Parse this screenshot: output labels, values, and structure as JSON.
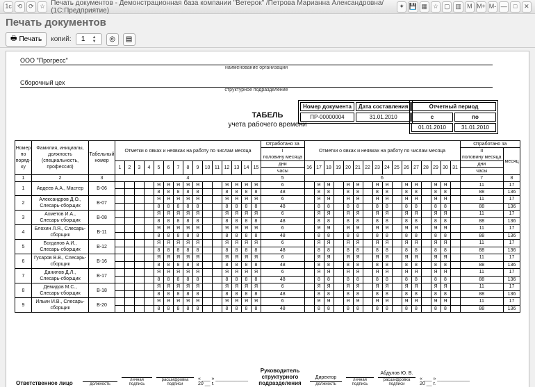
{
  "window": {
    "title": "Печать документов - Демонстрационная база компании \"Ветерок\" /Петрова Марианна Александровна/  (1С:Предприятие)"
  },
  "header": {
    "title": "Печать документов"
  },
  "toolbar": {
    "print": "Печать",
    "copies_label": "копий:",
    "copies": "1"
  },
  "org": {
    "name": "ООО \"Прогресс\"",
    "caption": "наименование организации"
  },
  "unit": {
    "name": "Сборочный цех",
    "caption": "структурное подразделение"
  },
  "title": {
    "main": "ТАБЕЛЬ",
    "sub": "учета рабочего времени"
  },
  "docinfo": {
    "num_h": "Номер документа",
    "date_h": "Дата составления",
    "num": "ПР-00000004",
    "date": "31.01.2010"
  },
  "period": {
    "title": "Отчетный период",
    "from_h": "с",
    "to_h": "по",
    "from": "01.01.2010",
    "to": "31.01.2010"
  },
  "table": {
    "h": {
      "num": "Номер по поряд-ку",
      "fio": "Фамилия, инициалы, должность (специальность, профессия)",
      "tab": "Табельный номер",
      "marks": "Отметки о явках и неявках на работу по числам месяца",
      "half1": "Отработано за",
      "half1b": "I",
      "half1c": "половину месяца",
      "dni": "дни",
      "chasy": "часы",
      "half2": "Отработано за",
      "half2b": "II",
      "half2c": "половину месяца",
      "mesyac": "месяц"
    },
    "cols": {
      "c1": "1",
      "c2": "2",
      "c3": "3",
      "c4": "4",
      "c5": "5",
      "c7": "7",
      "c8": "8"
    },
    "days1": [
      "1",
      "2",
      "3",
      "4",
      "5",
      "6",
      "7",
      "8",
      "9",
      "10",
      "11",
      "12",
      "13",
      "14",
      "15"
    ],
    "days2": [
      "16",
      "17",
      "18",
      "19",
      "20",
      "21",
      "22",
      "23",
      "24",
      "25",
      "26",
      "27",
      "28",
      "29",
      "30",
      "31"
    ],
    "rows": [
      {
        "n": "1",
        "fio": "Авдеев А.А., Мастер",
        "tab": "В-06",
        "d": "6",
        "h": "48",
        "d2": "11",
        "m": "17",
        "h2": "88",
        "mh": "136"
      },
      {
        "n": "2",
        "fio": "Александров Д.О., Слесарь-сборщик",
        "tab": "В-07",
        "d": "6",
        "h": "48",
        "d2": "11",
        "m": "17",
        "h2": "88",
        "mh": "136"
      },
      {
        "n": "3",
        "fio": "Ахметов И.А., Слесарь-сборщик",
        "tab": "В-08",
        "d": "6",
        "h": "48",
        "d2": "11",
        "m": "17",
        "h2": "88",
        "mh": "136"
      },
      {
        "n": "4",
        "fio": "Блохин Л.Я., Слесарь-сборщик",
        "tab": "В-11",
        "d": "6",
        "h": "48",
        "d2": "11",
        "m": "17",
        "h2": "88",
        "mh": "136"
      },
      {
        "n": "5",
        "fio": "Богданов А.И., Слесарь-сборщик",
        "tab": "В-12",
        "d": "6",
        "h": "48",
        "d2": "11",
        "m": "17",
        "h2": "88",
        "mh": "136"
      },
      {
        "n": "6",
        "fio": "Гусаров В.В., Слесарь-сборщик",
        "tab": "В-16",
        "d": "6",
        "h": "48",
        "d2": "11",
        "m": "17",
        "h2": "88",
        "mh": "136"
      },
      {
        "n": "7",
        "fio": "Данилов Д.Л., Слесарь-сборщик",
        "tab": "В-17",
        "d": "6",
        "h": "48",
        "d2": "11",
        "m": "17",
        "h2": "88",
        "mh": "136"
      },
      {
        "n": "8",
        "fio": "Демидов М.С., Слесарь-сборщик",
        "tab": "В-18",
        "d": "6",
        "h": "48",
        "d2": "11",
        "m": "17",
        "h2": "88",
        "mh": "136"
      },
      {
        "n": "9",
        "fio": "Ильин И.В., Слесарь-сборщик",
        "tab": "В-20",
        "d": "6",
        "h": "48",
        "d2": "11",
        "m": "17",
        "h2": "88",
        "mh": "136"
      }
    ]
  },
  "signatures": {
    "resp": "Ответственное лицо",
    "head": "Руководитель структурного подразделения",
    "dolzh": "должность",
    "podpis": "личная подпись",
    "rasshifr": "расшифровка подписи",
    "date_full": "« ___ » ____________ 20 __ г.",
    "director": "Директор",
    "name": "Абдулов Ю. В."
  }
}
